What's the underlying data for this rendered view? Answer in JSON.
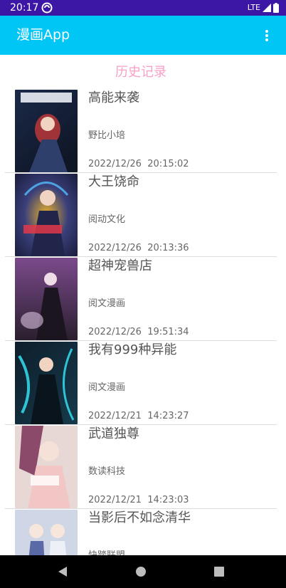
{
  "status_bar": {
    "time": "20:17",
    "network": "LTE"
  },
  "app_bar": {
    "title": "漫画App",
    "overflow_icon": "more-vert-icon"
  },
  "page": {
    "section_title": "历史记录"
  },
  "history": [
    {
      "title": "高能来袭",
      "author": "野比小培",
      "time": "2022/12/26  20:15:02",
      "cover_colors": [
        "#1b2a4a",
        "#c33a3a",
        "#eaeef5"
      ]
    },
    {
      "title": "大王饶命",
      "author": "阅动文化",
      "time": "2022/12/26  20:13:36",
      "cover_colors": [
        "#1a1d3d",
        "#e9b12a",
        "#4da3e0"
      ]
    },
    {
      "title": "超神宠兽店",
      "author": "阅文漫画",
      "time": "2022/12/26  19:51:34",
      "cover_colors": [
        "#2a1f2e",
        "#7b4a8c",
        "#d9c1e0"
      ]
    },
    {
      "title": "我有999种异能",
      "author": "阅文漫画",
      "time": "2022/12/21  14:23:27",
      "cover_colors": [
        "#0e1e2c",
        "#2fc3d6",
        "#9ad6e6"
      ]
    },
    {
      "title": "武道独尊",
      "author": "数读科技",
      "time": "2022/12/21  14:23:03",
      "cover_colors": [
        "#e7d8d6",
        "#8b4a6a",
        "#f3c6c6"
      ]
    },
    {
      "title": "当影后不如念清华",
      "author": "快踏联盟",
      "time": "",
      "cover_colors": [
        "#cfd6e6",
        "#5a6aa6",
        "#eef0f8"
      ]
    }
  ],
  "nav_bar": {
    "back_icon": "back-triangle-icon",
    "home_icon": "home-circle-icon",
    "recents_icon": "recents-square-icon"
  },
  "colors": {
    "status_bar": "#3c16a4",
    "app_bar": "#00c6f6",
    "section_title": "#f7a0c8"
  }
}
